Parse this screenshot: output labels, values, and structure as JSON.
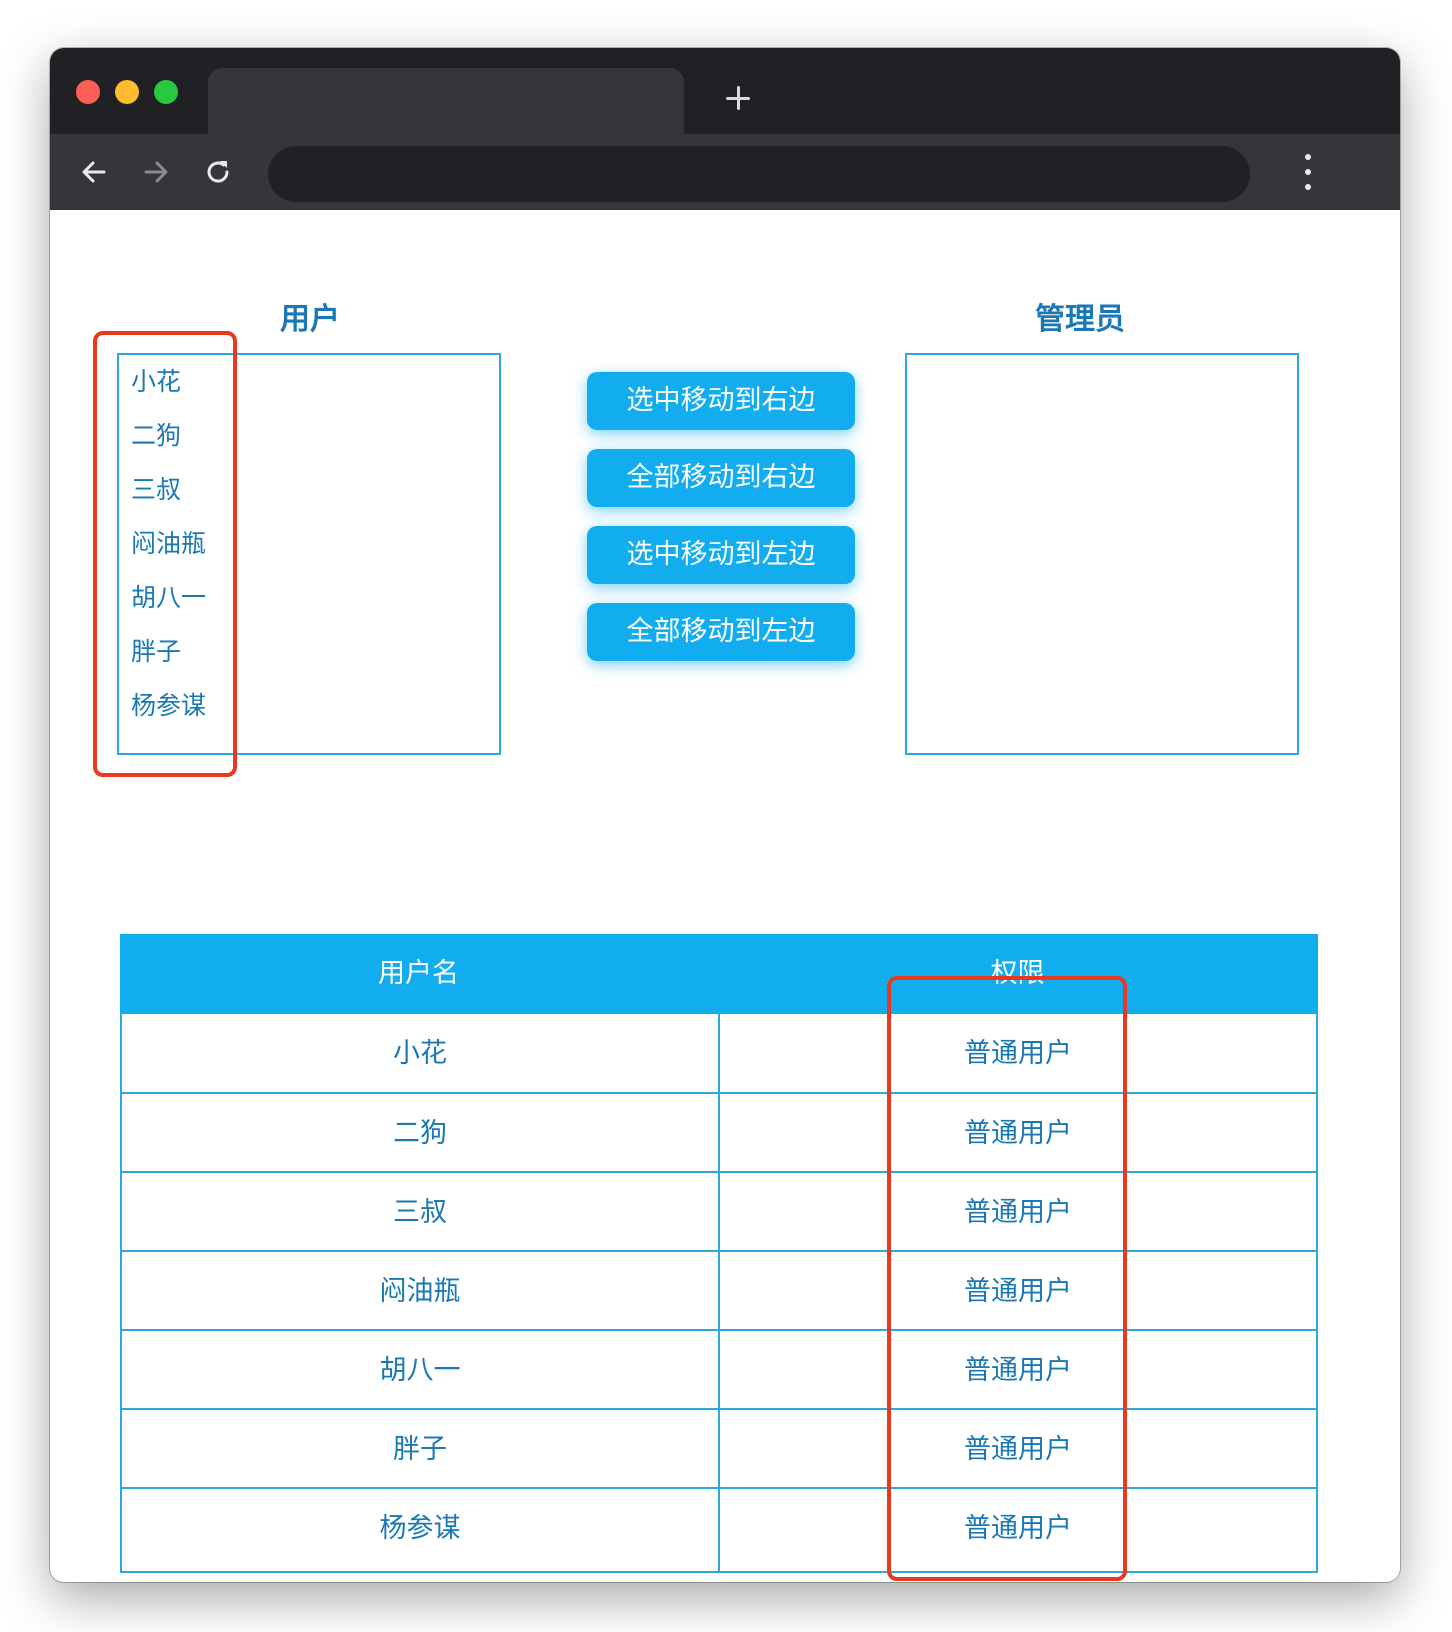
{
  "browser": {
    "tab_title": "",
    "address": ""
  },
  "left_panel": {
    "title": "用户",
    "items": [
      "小花",
      "二狗",
      "三叔",
      "闷油瓶",
      "胡八一",
      "胖子",
      "杨参谋"
    ]
  },
  "right_panel": {
    "title": "管理员",
    "items": []
  },
  "buttons": {
    "move_selected_right": "选中移动到右边",
    "move_all_right": "全部移动到右边",
    "move_selected_left": "选中移动到左边",
    "move_all_left": "全部移动到左边"
  },
  "table": {
    "headers": [
      "用户名",
      "权限"
    ],
    "rows": [
      {
        "name": "小花",
        "role": "普通用户"
      },
      {
        "name": "二狗",
        "role": "普通用户"
      },
      {
        "name": "三叔",
        "role": "普通用户"
      },
      {
        "name": "闷油瓶",
        "role": "普通用户"
      },
      {
        "name": "胡八一",
        "role": "普通用户"
      },
      {
        "name": "胖子",
        "role": "普通用户"
      },
      {
        "name": "杨参谋",
        "role": "普通用户"
      }
    ]
  },
  "colors": {
    "accent": "#12adef",
    "text": "#1a79b5",
    "border": "#2ea7e0",
    "highlight": "#e8381d"
  }
}
